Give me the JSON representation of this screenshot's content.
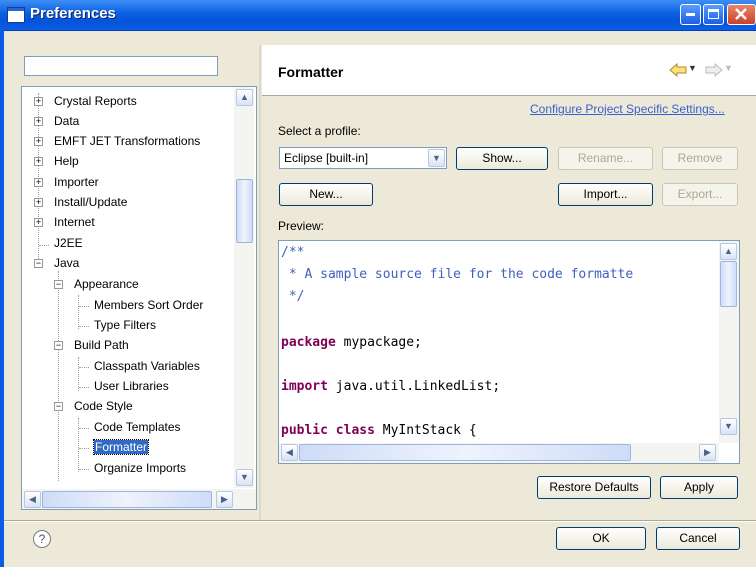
{
  "window": {
    "title": "Preferences"
  },
  "filter": {
    "value": ""
  },
  "tree": {
    "items": [
      {
        "label": "Crystal Reports"
      },
      {
        "label": "Data"
      },
      {
        "label": "EMFT JET Transformations"
      },
      {
        "label": "Help"
      },
      {
        "label": "Importer"
      },
      {
        "label": "Install/Update"
      },
      {
        "label": "Internet"
      },
      {
        "label": "J2EE"
      },
      {
        "label": "Java"
      },
      {
        "label": "Appearance"
      },
      {
        "label": "Members Sort Order"
      },
      {
        "label": "Type Filters"
      },
      {
        "label": "Build Path"
      },
      {
        "label": "Classpath Variables"
      },
      {
        "label": "User Libraries"
      },
      {
        "label": "Code Style"
      },
      {
        "label": "Code Templates"
      },
      {
        "label": "Formatter"
      },
      {
        "label": "Organize Imports"
      }
    ],
    "selected": "Formatter"
  },
  "page": {
    "title": "Formatter",
    "project_link": "Configure Project Specific Settings...",
    "profile_label": "Select a profile:",
    "profile_value": "Eclipse [built-in]",
    "buttons": {
      "show": "Show...",
      "rename": "Rename...",
      "remove": "Remove",
      "new": "New...",
      "import": "Import...",
      "export": "Export..."
    },
    "preview_label": "Preview:",
    "preview_lines": [
      "/**",
      " * A sample source file for the code formatte",
      " */",
      "package mypackage;",
      "import java.util.LinkedList;",
      "public class MyIntStack {"
    ],
    "restore_defaults": "Restore Defaults",
    "apply": "Apply"
  },
  "footer": {
    "help": "?",
    "ok": "OK",
    "cancel": "Cancel"
  },
  "colors": {
    "titlebar": "#0a5fe0",
    "dialog_bg": "#ece9d8",
    "selection": "#316ac5",
    "code_comment": "#3f5fbf",
    "code_keyword": "#7f0055",
    "link": "#3a5fcd"
  },
  "icons": {
    "nav_back": "arrow-left-icon",
    "nav_forward": "arrow-right-icon",
    "help": "question-circle-icon"
  }
}
